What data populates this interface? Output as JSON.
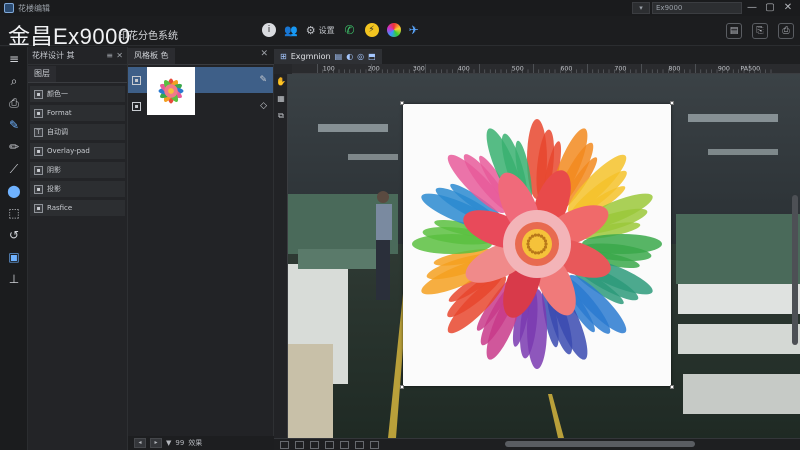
{
  "titlebar": {
    "title": "花楼编辑",
    "select_value": "",
    "profile_value": "Ex9000"
  },
  "header": {
    "brand": "金昌Ex9000",
    "subtitle": "印花分色系统",
    "tools": [
      {
        "icon": "info-icon",
        "label": ""
      },
      {
        "icon": "users-icon",
        "label": ""
      },
      {
        "icon": "settings-icon",
        "label": "设置"
      },
      {
        "icon": "phone-icon",
        "label": ""
      },
      {
        "icon": "lightning-icon",
        "label": ""
      },
      {
        "icon": "color-wheel-icon",
        "label": ""
      },
      {
        "icon": "pin-icon",
        "label": ""
      }
    ]
  },
  "layers_panel": {
    "title": "花样设计 其",
    "tab": "图层",
    "items": [
      {
        "label": "颜色一"
      },
      {
        "label": "Format"
      },
      {
        "label": "自动调"
      },
      {
        "label": "Overlay-pad"
      },
      {
        "label": "阴影"
      },
      {
        "label": "投影"
      },
      {
        "label": "Rasfice"
      }
    ]
  },
  "channels_panel": {
    "tab": "风格板",
    "tab_extra": "色"
  },
  "document": {
    "tab_label": "Exgmnion"
  },
  "ruler": {
    "labels": [
      "100",
      "200",
      "300",
      "400",
      "500",
      "600",
      "700",
      "800",
      "900",
      "PA500"
    ]
  },
  "statusbar": {
    "zoom_label": "99",
    "info": "效果"
  },
  "colors": {
    "accent": "#3e5f88",
    "background": "#1e1f21"
  }
}
